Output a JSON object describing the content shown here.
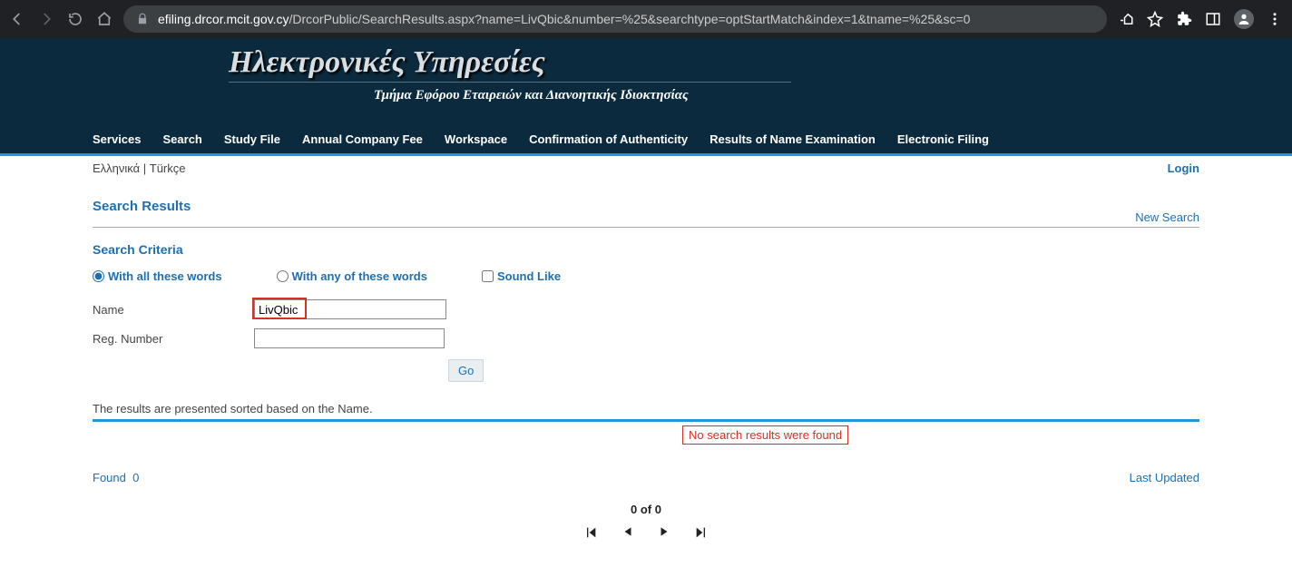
{
  "browser": {
    "url_host": "efiling.drcor.mcit.gov.cy",
    "url_path": "/DrcorPublic/SearchResults.aspx?name=LivQbic&number=%25&searchtype=optStartMatch&index=1&tname=%25&sc=0"
  },
  "header": {
    "title": "Ηλεκτρονικές Υπηρεσίες",
    "subtitle": "Τμήμα Εφόρου Εταιρειών και Διανοητικής Ιδιοκτησίας"
  },
  "nav": [
    "Services",
    "Search",
    "Study File",
    "Annual Company Fee",
    "Workspace",
    "Confirmation of Authenticity",
    "Results of Name Examination",
    "Electronic Filing"
  ],
  "langs": {
    "el": "Ελληνικά",
    "sep": " | ",
    "tr": "Türkçe"
  },
  "login": "Login",
  "page": {
    "title": "Search Results",
    "new_search": "New Search",
    "criteria_title": "Search Criteria",
    "opt_all": "With all these words",
    "opt_any": "With any of these words",
    "opt_sound": "Sound Like",
    "name_label": "Name",
    "name_value": "LivQbic",
    "reg_label": "Reg. Number",
    "reg_value": "",
    "go": "Go",
    "results_note": "The results are presented sorted based on the Name.",
    "no_results": "No search results were found",
    "found_label": "Found",
    "found_count": "0",
    "last_updated": "Last Updated",
    "pager_pos": "0 of 0"
  }
}
